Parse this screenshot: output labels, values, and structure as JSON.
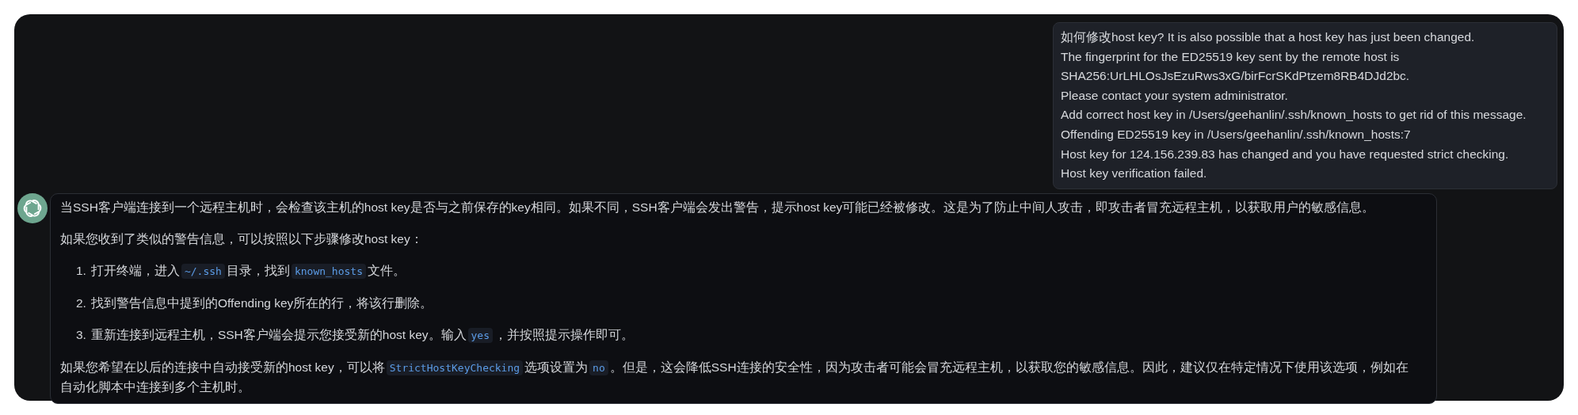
{
  "user_message": {
    "lines": [
      "如何修改host key?  It is also possible that a host key has just been changed.",
      "The fingerprint for the ED25519 key sent by the remote host is",
      "SHA256:UrLHLOsJsEzuRws3xG/birFcrSKdPtzem8RB4DJd2bc.",
      "Please contact your system administrator.",
      "Add correct host key in /Users/geehanlin/.ssh/known_hosts to get rid of this message.",
      "Offending ED25519 key in /Users/geehanlin/.ssh/known_hosts:7",
      "Host key for 124.156.239.83 has changed and you have requested strict checking.",
      "Host key verification failed."
    ]
  },
  "assistant_message": {
    "blocks": [
      {
        "kind": "paragraph",
        "segments": [
          {
            "kind": "text",
            "text": "当SSH客户端连接到一个远程主机时，会检查该主机的host key是否与之前保存的key相同。如果不同，SSH客户端会发出警告，提示host key可能已经被修改。这是为了防止中间人攻击，即攻击者冒充远程主机，以获取用户的敏感信息。"
          }
        ]
      },
      {
        "kind": "paragraph",
        "segments": [
          {
            "kind": "text",
            "text": "如果您收到了类似的警告信息，可以按照以下步骤修改host key："
          }
        ]
      },
      {
        "kind": "list_item",
        "number": "1.",
        "segments": [
          {
            "kind": "text",
            "text": "打开终端，进入"
          },
          {
            "kind": "code",
            "text": "~/.ssh"
          },
          {
            "kind": "text",
            "text": "目录，找到"
          },
          {
            "kind": "code",
            "text": "known_hosts"
          },
          {
            "kind": "text",
            "text": "文件。"
          }
        ]
      },
      {
        "kind": "list_item",
        "number": "2.",
        "segments": [
          {
            "kind": "text",
            "text": "找到警告信息中提到的Offending key所在的行，将该行删除。"
          }
        ]
      },
      {
        "kind": "list_item",
        "number": "3.",
        "segments": [
          {
            "kind": "text",
            "text": "重新连接到远程主机，SSH客户端会提示您接受新的host key。输入"
          },
          {
            "kind": "code",
            "text": "yes"
          },
          {
            "kind": "text",
            "text": "，并按照提示操作即可。"
          }
        ]
      },
      {
        "kind": "paragraph",
        "segments": [
          {
            "kind": "text",
            "text": "如果您希望在以后的连接中自动接受新的host key，可以将"
          },
          {
            "kind": "code",
            "text": "StrictHostKeyChecking"
          },
          {
            "kind": "text",
            "text": "选项设置为"
          },
          {
            "kind": "code",
            "text": "no"
          },
          {
            "kind": "text",
            "text": "。但是，这会降低SSH连接的安全性，因为攻击者可能会冒充远程主机，以获取您的敏感信息。因此，建议仅在特定情况下使用该选项，例如在自动化脚本中连接到多个主机时。"
          }
        ]
      }
    ]
  }
}
